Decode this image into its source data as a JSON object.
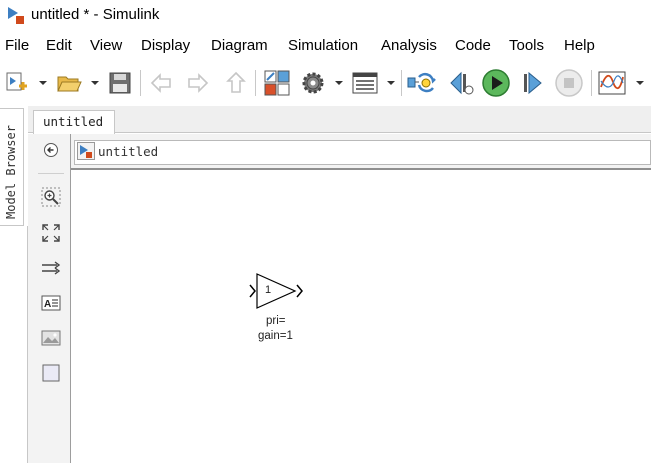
{
  "window": {
    "title": "untitled * - Simulink",
    "icon": "simulink-icon"
  },
  "menu": {
    "items": [
      "File",
      "Edit",
      "View",
      "Display",
      "Diagram",
      "Simulation",
      "Analysis",
      "Code",
      "Tools",
      "Help"
    ]
  },
  "toolbar": {
    "buttons": [
      {
        "name": "new-model-icon",
        "dropdown": true
      },
      {
        "name": "open-folder-icon",
        "dropdown": true
      },
      {
        "name": "save-icon"
      },
      {
        "name": "back-arrow-icon"
      },
      {
        "name": "forward-arrow-icon"
      },
      {
        "name": "up-arrow-icon"
      },
      {
        "name": "library-browser-icon"
      },
      {
        "name": "settings-gear-icon",
        "dropdown": true
      },
      {
        "name": "model-explorer-icon",
        "dropdown": true
      },
      {
        "name": "update-diagram-icon"
      },
      {
        "name": "step-back-icon"
      },
      {
        "name": "run-icon"
      },
      {
        "name": "step-forward-icon"
      },
      {
        "name": "stop-icon"
      },
      {
        "name": "scope-icon",
        "dropdown": true
      }
    ]
  },
  "sidebar": {
    "model_browser_label": "Model Browser"
  },
  "editor": {
    "tab_label": "untitled",
    "breadcrumb": "untitled"
  },
  "palette": {
    "tools": [
      "hide-browser-icon",
      "zoom-icon",
      "fit-view-icon",
      "signal-route-icon",
      "annotation-icon",
      "image-icon",
      "area-icon"
    ]
  },
  "block": {
    "type": "Gain",
    "gain_value": "1",
    "label_line1": "pri=",
    "label_line2": "gain=1"
  }
}
